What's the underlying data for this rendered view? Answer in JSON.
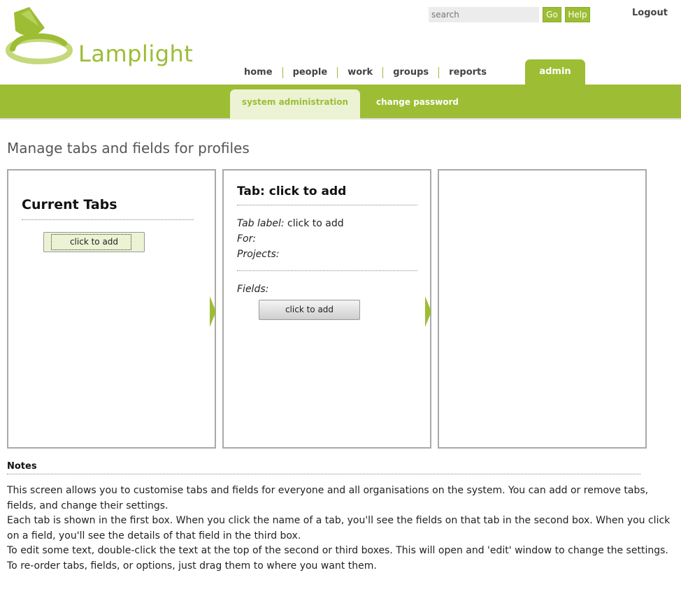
{
  "header": {
    "logo_text": "Lamplight",
    "search_placeholder": "search",
    "go_label": "Go",
    "help_label": "Help",
    "logout_label": "Logout",
    "accent_color": "#9dbd34"
  },
  "nav": {
    "items": [
      {
        "label": "home"
      },
      {
        "label": "people"
      },
      {
        "label": "work"
      },
      {
        "label": "groups"
      },
      {
        "label": "reports"
      },
      {
        "label": "admin",
        "active": true
      }
    ]
  },
  "subnav": {
    "items": [
      {
        "label": "system administration",
        "active": true
      },
      {
        "label": "change password"
      }
    ]
  },
  "page": {
    "title": "Manage tabs and fields for profiles"
  },
  "box1": {
    "heading": "Current Tabs",
    "add_label": "click to add"
  },
  "box2": {
    "heading": "Tab: click to add",
    "tab_label_key": "Tab label:",
    "tab_label_value": "click to add",
    "for_key": "For:",
    "projects_key": "Projects:",
    "fields_key": "Fields:",
    "add_label": "click to add"
  },
  "notes": {
    "title": "Notes",
    "paragraphs": [
      "This screen allows you to customise tabs and fields for everyone and all organisations on the system. You can add or remove tabs, fields, and change their settings.",
      "Each tab is shown in the first box. When you click the name of a tab, you'll see the fields on that tab in the second box. When you click on a field, you'll see the details of that field in the third box.",
      "To edit some text, double-click the text at the top of the second or third boxes. This will open and 'edit' window to change the settings.",
      "To re-order tabs, fields, or options, just drag them to where you want them."
    ]
  }
}
